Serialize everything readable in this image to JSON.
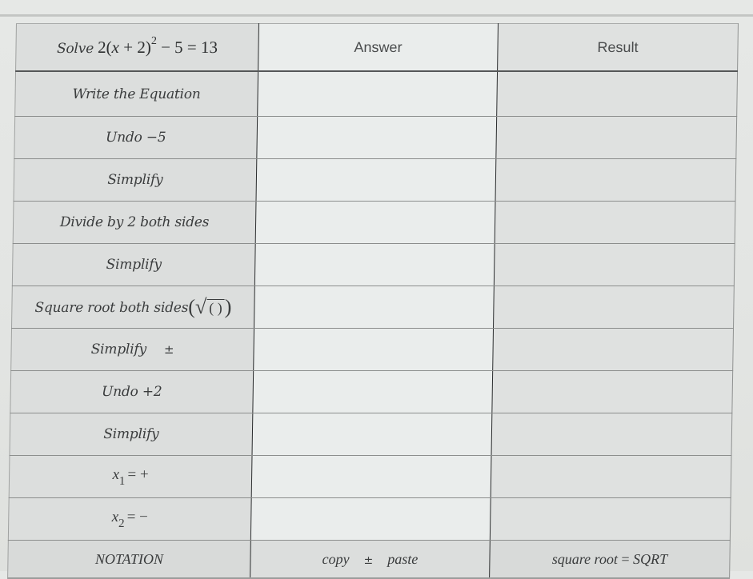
{
  "worksheet": {
    "header": {
      "problem_prefix": "Solve",
      "equation": {
        "coef": "2(",
        "var": "x",
        "inner": " + 2)",
        "exponent": "2",
        "rest": " − 5 = 13"
      },
      "answer_label": "Answer",
      "result_label": "Result"
    },
    "steps": [
      {
        "label": "Write the Equation",
        "answer": "",
        "result": ""
      },
      {
        "label": "Undo −5",
        "answer": "",
        "result": ""
      },
      {
        "label": "Simplify",
        "answer": "",
        "result": ""
      },
      {
        "label": "Divide by 2 both sides",
        "answer": "",
        "result": ""
      },
      {
        "label": "Simplify",
        "answer": "",
        "result": ""
      },
      {
        "label": "Square root both sides",
        "sqrt_symbol": "√",
        "sqrt_inner": "( )",
        "open_paren": "(",
        "close_paren": ")",
        "answer": "",
        "result": ""
      },
      {
        "label": "Simplify",
        "symbol": "±",
        "answer": "",
        "result": ""
      },
      {
        "label": "Undo +2",
        "answer": "",
        "result": ""
      },
      {
        "label": "Simplify",
        "answer": "",
        "result": ""
      },
      {
        "var": "x",
        "subscript": "1",
        "equals": "= +",
        "answer": "",
        "result": ""
      },
      {
        "var": "x",
        "subscript": "2",
        "equals": "= −",
        "answer": "",
        "result": ""
      }
    ],
    "notation": {
      "label": "NOTATION",
      "copy": "copy",
      "pm": "±",
      "paste": "paste",
      "sqrt_text": "square root",
      "sqrt_eq": "=",
      "sqrt_code": "SQRT"
    }
  }
}
